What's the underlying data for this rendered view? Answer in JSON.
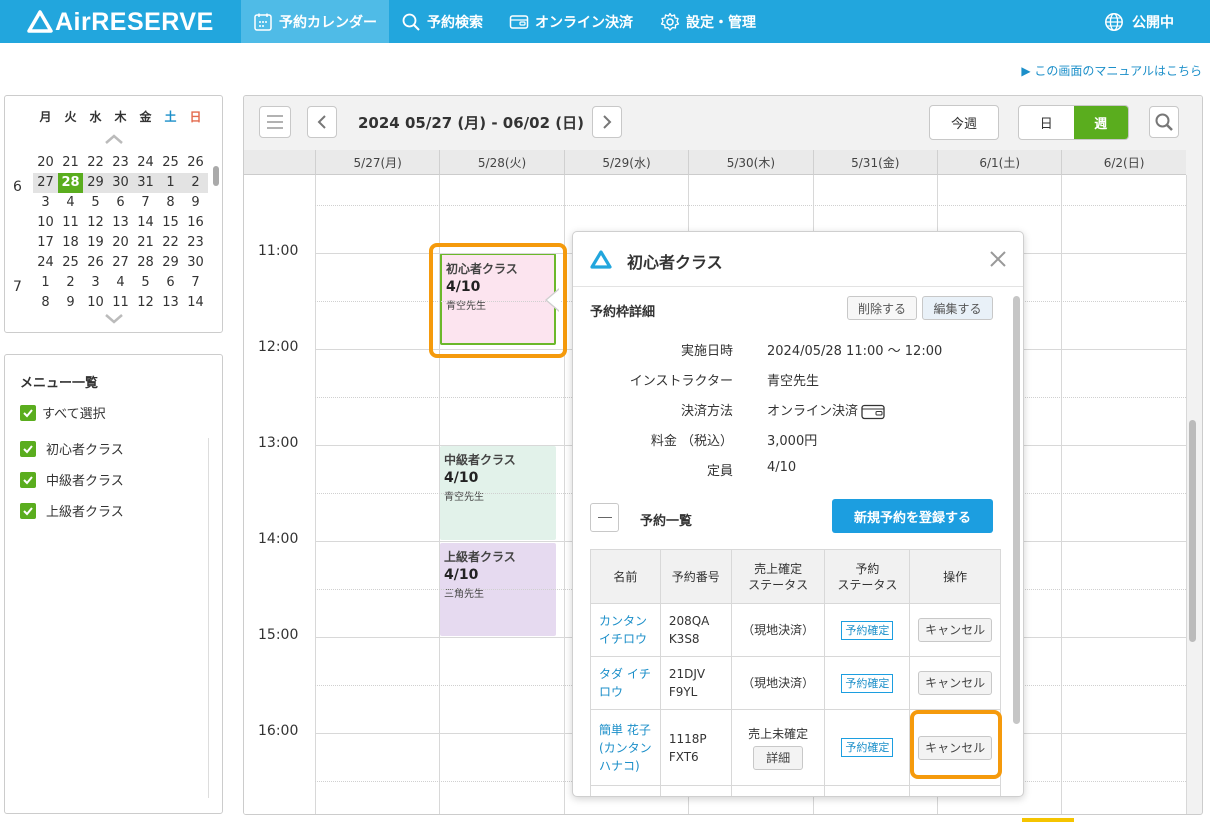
{
  "header": {
    "logo_text": "AirRESERVE",
    "nav": [
      {
        "label": "予約カレンダー",
        "icon": "calendar-icon",
        "active": true
      },
      {
        "label": "予約検索",
        "icon": "search-icon",
        "active": false
      },
      {
        "label": "オンライン決済",
        "icon": "wallet-icon",
        "active": false
      },
      {
        "label": "設定・管理",
        "icon": "gear-icon",
        "active": false
      }
    ],
    "status": "公開中",
    "accent": "#22a6dd"
  },
  "manual_link": "▶ この画面のマニュアルはこちら",
  "mini_calendar": {
    "weekdays": [
      "月",
      "火",
      "水",
      "木",
      "金",
      "土",
      "日"
    ],
    "rows": [
      {
        "month": "",
        "days": [
          "20",
          "21",
          "22",
          "23",
          "24",
          "25",
          "26"
        ]
      },
      {
        "month": "6",
        "days": [
          "27",
          "28",
          "29",
          "30",
          "31",
          "1",
          "2"
        ]
      },
      {
        "month": "",
        "days": [
          "3",
          "4",
          "5",
          "6",
          "7",
          "8",
          "9"
        ]
      },
      {
        "month": "",
        "days": [
          "10",
          "11",
          "12",
          "13",
          "14",
          "15",
          "16"
        ]
      },
      {
        "month": "",
        "days": [
          "17",
          "18",
          "19",
          "20",
          "21",
          "22",
          "23"
        ]
      },
      {
        "month": "",
        "days": [
          "24",
          "25",
          "26",
          "27",
          "28",
          "29",
          "30"
        ]
      },
      {
        "month": "7",
        "days": [
          "1",
          "2",
          "3",
          "4",
          "5",
          "6",
          "7"
        ]
      },
      {
        "month": "",
        "days": [
          "8",
          "9",
          "10",
          "11",
          "12",
          "13",
          "14"
        ]
      }
    ],
    "today": "28"
  },
  "menu": {
    "title": "メニュー一覧",
    "select_all": "すべて選択",
    "items": [
      "初心者クラス",
      "中級者クラス",
      "上級者クラス"
    ]
  },
  "calendar": {
    "range": "2024 05/27 (月) - 06/02 (日)",
    "this_week": "今週",
    "view_day": "日",
    "view_week": "週",
    "days": [
      "5/27(月)",
      "5/28(火)",
      "5/29(水)",
      "5/30(木)",
      "5/31(金)",
      "6/1(土)",
      "6/2(日)"
    ],
    "times": [
      "11:00",
      "12:00",
      "13:00",
      "14:00",
      "15:00",
      "16:00"
    ],
    "events": [
      {
        "title": "初心者クラス",
        "count": "4/10",
        "instructor": "青空先生",
        "color": "#fce4ef"
      },
      {
        "title": "中級者クラス",
        "count": "4/10",
        "instructor": "青空先生",
        "color": "#e2f2ea"
      },
      {
        "title": "上級者クラス",
        "count": "4/10",
        "instructor": "三角先生",
        "color": "#e6daf0"
      }
    ]
  },
  "popover": {
    "title": "初心者クラス",
    "section_title": "予約枠詳細",
    "delete": "削除する",
    "edit": "編集する",
    "details": [
      {
        "key": "実施日時",
        "value": "2024/05/28 11:00 〜 12:00"
      },
      {
        "key": "インストラクター",
        "value": "青空先生"
      },
      {
        "key": "決済方法",
        "value": "オンライン決済"
      },
      {
        "key": "料金 （税込）",
        "value": "3,000円"
      },
      {
        "key": "定員",
        "value": "4/10"
      }
    ],
    "list_title": "予約一覧",
    "add_button": "新規予約を登録する",
    "table": {
      "headers": [
        "名前",
        "予約番号",
        "売上確定\nステータス",
        "予約\nステータス",
        "操作"
      ],
      "rows": [
        {
          "name": "カンタン\nイチロウ",
          "number": "208QA\nK3S8",
          "sales": "（現地決済）",
          "detail": "",
          "status": "予約確定",
          "action": "キャンセル"
        },
        {
          "name": "タダ イチ\nロウ",
          "number": "21DJV\nF9YL",
          "sales": "（現地決済）",
          "detail": "",
          "status": "予約確定",
          "action": "キャンセル"
        },
        {
          "name": "簡単 花子\n(カンタン\nハナコ)",
          "number": "1118P\nFXT6",
          "sales": "売上未確定",
          "detail": "詳細",
          "status": "予約確定",
          "action": "キャンセル"
        }
      ]
    }
  }
}
